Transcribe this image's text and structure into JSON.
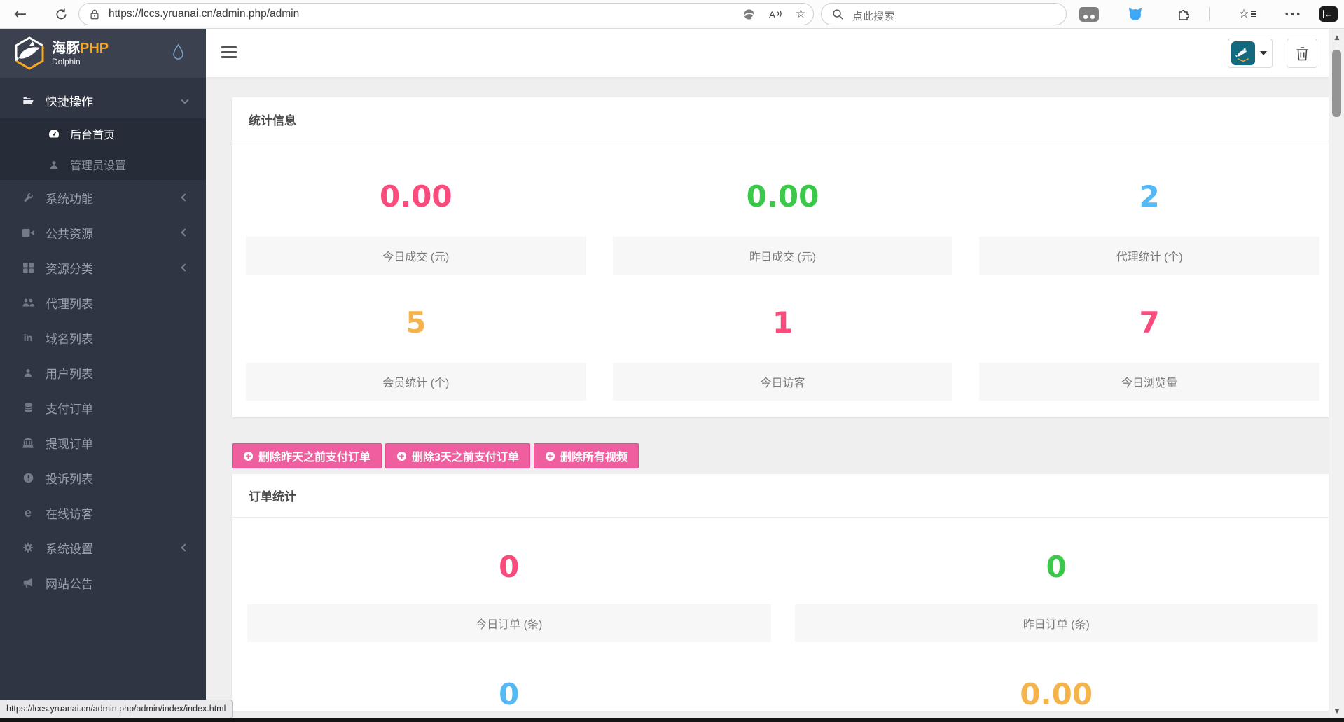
{
  "browser": {
    "url": "https://lccs.yruanai.cn/admin.php/admin",
    "search_placeholder": "点此搜索"
  },
  "sidebar": {
    "brand": {
      "cn": "海豚",
      "php": "PHP",
      "sub": "Dolphin"
    },
    "items": [
      {
        "label": "快捷操作",
        "state": "expanded",
        "children": [
          {
            "label": "后台首页",
            "state": "active"
          },
          {
            "label": "管理员设置",
            "state": "normal"
          }
        ]
      },
      {
        "label": "系统功能",
        "collapsible": true
      },
      {
        "label": "公共资源",
        "collapsible": true
      },
      {
        "label": "资源分类",
        "collapsible": true
      },
      {
        "label": "代理列表"
      },
      {
        "label": "域名列表"
      },
      {
        "label": "用户列表"
      },
      {
        "label": "支付订单"
      },
      {
        "label": "提现订单"
      },
      {
        "label": "投诉列表"
      },
      {
        "label": "在线访客"
      },
      {
        "label": "系统设置",
        "collapsible": true
      },
      {
        "label": "网站公告"
      }
    ]
  },
  "panels": {
    "stats": {
      "title": "统计信息",
      "cells": [
        {
          "value": "0.00",
          "label": "今日成交 (元)",
          "color": "pink"
        },
        {
          "value": "0.00",
          "label": "昨日成交 (元)",
          "color": "green"
        },
        {
          "value": "2",
          "label": "代理统计 (个)",
          "color": "blue"
        },
        {
          "value": "5",
          "label": "会员统计 (个)",
          "color": "orange"
        },
        {
          "value": "1",
          "label": "今日访客",
          "color": "pink"
        },
        {
          "value": "7",
          "label": "今日浏览量",
          "color": "pink"
        }
      ]
    },
    "orders": {
      "title": "订单统计",
      "cells": [
        {
          "value": "0",
          "label": "今日订单 (条)",
          "color": "pink"
        },
        {
          "value": "0",
          "label": "昨日订单 (条)",
          "color": "green"
        },
        {
          "value": "0",
          "label": "",
          "color": "blue"
        },
        {
          "value": "0.00",
          "label": "",
          "color": "orange"
        }
      ]
    }
  },
  "actions": {
    "buttons": [
      {
        "label": "删除昨天之前支付订单"
      },
      {
        "label": "删除3天之前支付订单"
      },
      {
        "label": "删除所有视频"
      }
    ]
  },
  "statusbar": {
    "link_preview": "https://lccs.yruanai.cn/admin.php/admin/index/index.html"
  },
  "colors": {
    "pink": "#fa4b7d",
    "green": "#3cc84b",
    "blue": "#55b9f5",
    "orange": "#f5b44b",
    "button_pink": "#ef5f9f",
    "brand_orange": "#f5a623",
    "avatar_teal": "#15697f"
  }
}
